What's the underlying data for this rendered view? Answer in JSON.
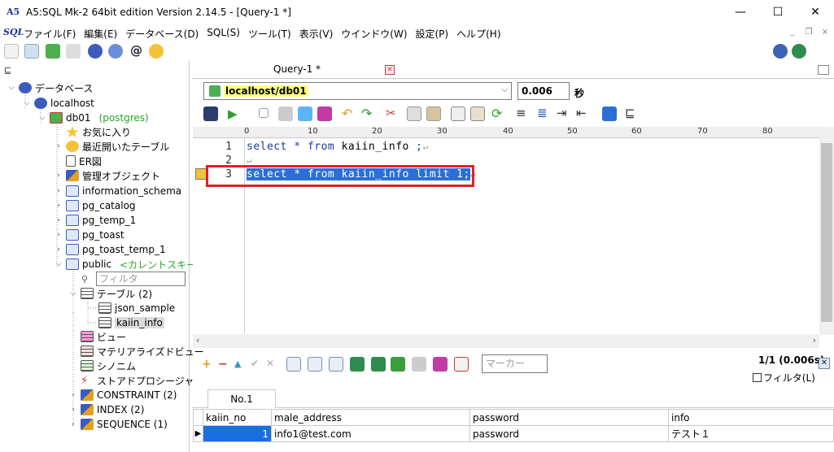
{
  "window": {
    "title": "A5:SQL Mk-2 64bit edition Version 2.14.5 - [Query-1 *]",
    "app_icon_text": "A5",
    "minimize": "—",
    "maximize": "☐",
    "close": "✕"
  },
  "menubar": {
    "logo": "SQL",
    "items": [
      {
        "label": "ファイル(F)"
      },
      {
        "label": "編集(E)"
      },
      {
        "label": "データベース(D)"
      },
      {
        "label": "SQL(S)"
      },
      {
        "label": "ツール(T)"
      },
      {
        "label": "表示(V)"
      },
      {
        "label": "ウインドウ(W)"
      },
      {
        "label": "設定(P)"
      },
      {
        "label": "ヘルプ(H)"
      }
    ],
    "mdi_min": "_",
    "mdi_restore": "❐",
    "mdi_close": "×"
  },
  "tree": {
    "root": "データベース",
    "server": "localhost",
    "db": "db01",
    "db_sub": "(postgres)",
    "favorites": "お気に入り",
    "recent": "最近開いたテーブル",
    "er": "ER図",
    "admin": "管理オブジェクト",
    "schemas": [
      "information_schema",
      "pg_catalog",
      "pg_temp_1",
      "pg_toast",
      "pg_toast_temp_1"
    ],
    "public": "public",
    "public_sub": "<カレントスキーマ",
    "filter_placeholder": "フィルタ",
    "tables": "テーブル (2)",
    "table_items": [
      "json_sample",
      "kaiin_info"
    ],
    "view": "ビュー",
    "matview": "マテリアライズドビュー",
    "synonym": "シノニム",
    "stored": "ストアドプロシージャ",
    "constraint": "CONSTRAINT (2)",
    "index": "INDEX (2)",
    "sequence": "SEQUENCE (1)"
  },
  "editor": {
    "tab": "Query-1 *",
    "tab_close": "✕",
    "connection": "localhost/db01",
    "exec_time": "0.006",
    "time_unit": "秒",
    "ruler": [
      "0",
      "10",
      "20",
      "30",
      "40",
      "50",
      "60",
      "70",
      "80"
    ],
    "lines": [
      {
        "no": "1",
        "kw1": "select * from ",
        "ident": "kaiin_info",
        "kw2": " ;",
        "eol": "↵"
      },
      {
        "no": "2",
        "kw1": "",
        "ident": "",
        "kw2": "",
        "eol": "↵"
      },
      {
        "no": "3",
        "kw1": "select * from ",
        "ident": "kaiin_info",
        "kw2": " limit 1;",
        "eol": "↵"
      }
    ]
  },
  "results": {
    "marker_placeholder": "マーカー",
    "count": "1/1 (0.006s)",
    "filter_label": "フィルタ(L)",
    "tab": "No.1",
    "columns": [
      "kaiin_no",
      "male_address",
      "password",
      "info"
    ],
    "rows": [
      {
        "marker": "▶",
        "values": [
          "1",
          "info1@test.com",
          "password",
          "テスト１"
        ]
      }
    ]
  }
}
